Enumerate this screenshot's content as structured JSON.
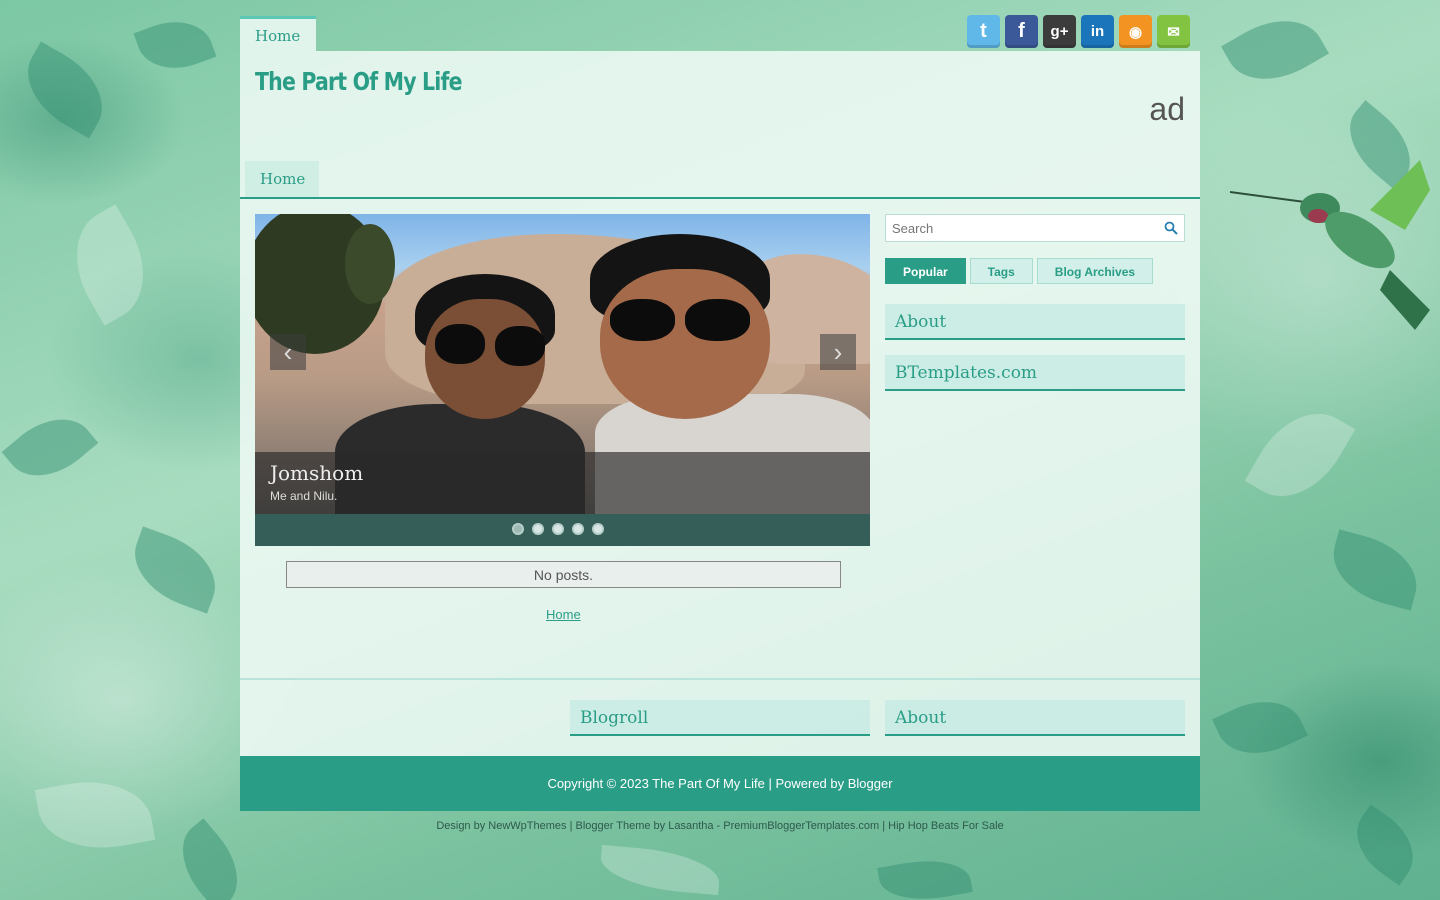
{
  "top_nav": {
    "home": "Home"
  },
  "social": [
    {
      "name": "twitter-icon",
      "glyph": "t",
      "color": "#5fb8e8"
    },
    {
      "name": "facebook-icon",
      "glyph": "f",
      "color": "#3b5998"
    },
    {
      "name": "google-plus-icon",
      "glyph": "g+",
      "color": "#3c3c3c"
    },
    {
      "name": "linkedin-icon",
      "glyph": "in",
      "color": "#1b75bb"
    },
    {
      "name": "rss-icon",
      "glyph": "rss",
      "color": "#f39321"
    },
    {
      "name": "email-icon",
      "glyph": "mail",
      "color": "#82c341"
    }
  ],
  "header": {
    "title": "The Part Of My Life",
    "ad": "ad"
  },
  "main_nav": {
    "home": "Home"
  },
  "slider": {
    "caption_title": "Jomshom",
    "caption_text": "Me and Nilu.",
    "prev": "‹",
    "next": "›",
    "dot_count": 5,
    "active_dot": 1
  },
  "posts": {
    "no_posts": "No posts.",
    "home_link": "Home"
  },
  "sidebar": {
    "search_placeholder": "Search",
    "tabs": [
      "Popular",
      "Tags",
      "Blog Archives"
    ],
    "widgets": [
      "About",
      "BTemplates.com"
    ]
  },
  "footer_widgets": {
    "blogroll": "Blogroll",
    "about": "About"
  },
  "footer": {
    "copyright": "Copyright © 2023 The Part Of My Life | Powered by Blogger",
    "credits": "Design by NewWpThemes | Blogger Theme by Lasantha - PremiumBloggerTemplates.com | Hip Hop Beats For Sale"
  },
  "colors": {
    "accent": "#2a9d87",
    "accent_light": "#5cc7b5"
  }
}
